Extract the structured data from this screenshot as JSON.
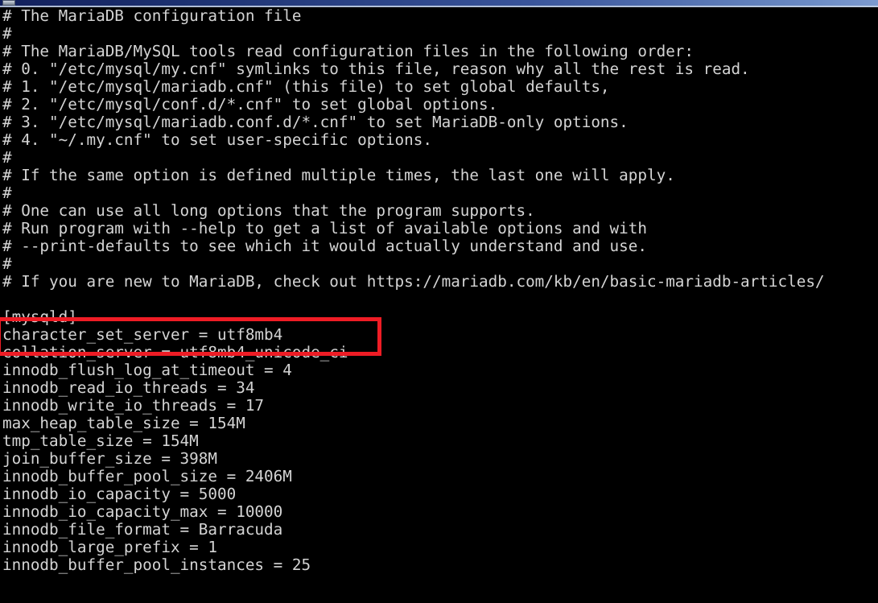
{
  "window": {
    "titlebar_icon": "terminal-window-icon",
    "title": ""
  },
  "terminal": {
    "prompt_background": "#000000",
    "text_color": "#d4d4d4",
    "lines": [
      "# The MariaDB configuration file",
      "#",
      "# The MariaDB/MySQL tools read configuration files in the following order:",
      "# 0. \"/etc/mysql/my.cnf\" symlinks to this file, reason why all the rest is read.",
      "# 1. \"/etc/mysql/mariadb.cnf\" (this file) to set global defaults,",
      "# 2. \"/etc/mysql/conf.d/*.cnf\" to set global options.",
      "# 3. \"/etc/mysql/mariadb.conf.d/*.cnf\" to set MariaDB-only options.",
      "# 4. \"~/.my.cnf\" to set user-specific options.",
      "#",
      "# If the same option is defined multiple times, the last one will apply.",
      "#",
      "# One can use all long options that the program supports.",
      "# Run program with --help to get a list of available options and with",
      "# --print-defaults to see which it would actually understand and use.",
      "#",
      "# If you are new to MariaDB, check out https://mariadb.com/kb/en/basic-mariadb-articles/",
      "",
      "[mysqld]",
      "character_set_server = utf8mb4",
      "collation_server = utf8mb4_unicode_ci",
      "innodb_flush_log_at_timeout = 4",
      "innodb_read_io_threads = 34",
      "innodb_write_io_threads = 17",
      "max_heap_table_size = 154M",
      "tmp_table_size = 154M",
      "join_buffer_size = 398M",
      "innodb_buffer_pool_size = 2406M",
      "innodb_io_capacity = 5000",
      "innodb_io_capacity_max = 10000",
      "innodb_file_format = Barracuda",
      "innodb_large_prefix = 1",
      "innodb_buffer_pool_instances = 25"
    ]
  },
  "annotation": {
    "type": "rectangle-highlight",
    "color": "#ee1c25",
    "stroke_width_px": 5,
    "highlighted_lines": [
      "character_set_server = utf8mb4",
      "collation_server = utf8mb4_unicode_ci"
    ]
  }
}
